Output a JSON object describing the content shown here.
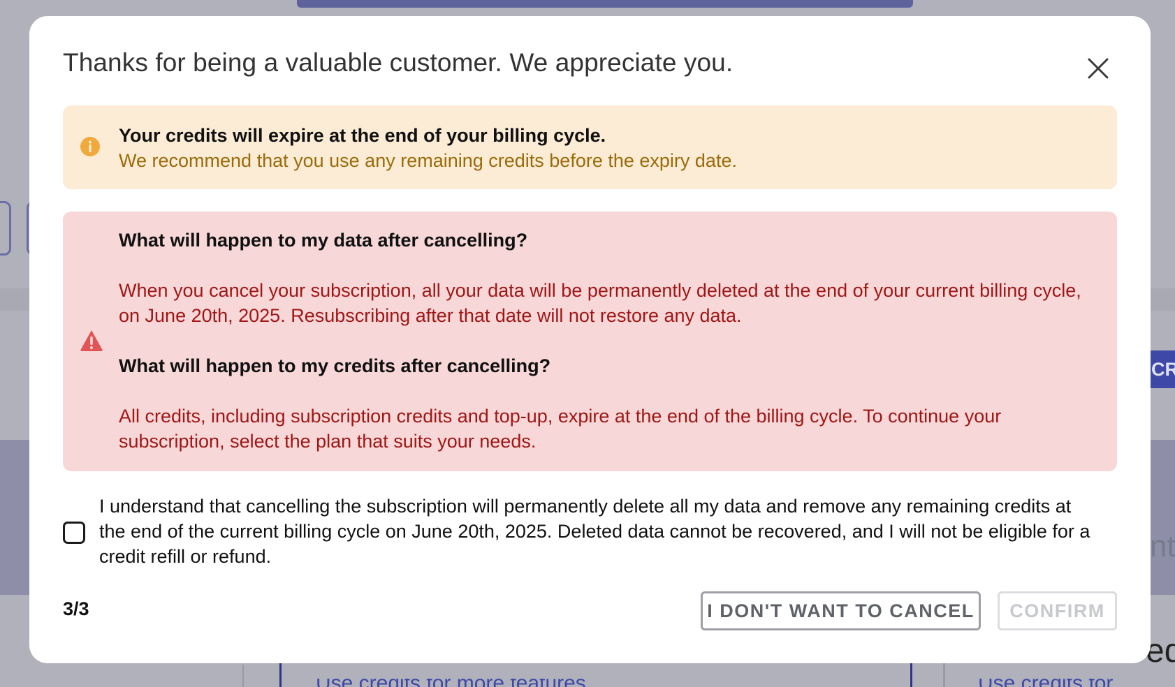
{
  "background": {
    "partial_button_text": "CR",
    "partial_text_right": "nt",
    "partial_heading_right": "ed",
    "partial_link_left": "Use credits for more features",
    "partial_link_right": "Use credits for"
  },
  "modal": {
    "title": "Thanks for being a valuable customer. We appreciate you.",
    "close_label": "Close",
    "warning_alert": {
      "icon": "info-icon",
      "heading": "Your credits will expire at the end of your billing cycle.",
      "body": "We recommend that you use any remaining credits before the expiry date."
    },
    "error_alert": {
      "icon": "warning-triangle-icon",
      "q1_heading": "What will happen to my data after cancelling?",
      "q1_body": "When you cancel your subscription, all your data will be permanently deleted at the end of your current billing cycle, on June 20th, 2025. Resubscribing after that date will not restore any data.",
      "q2_heading": "What will happen to my credits after cancelling?",
      "q2_body": "All credits, including subscription credits and top-up, expire at the end of the billing cycle. To continue your subscription, select the plan that suits your needs."
    },
    "acknowledgement": {
      "checked": false,
      "text": "I understand that cancelling the subscription will permanently delete all my data and remove any remaining credits at the end of the current billing cycle on June 20th, 2025. Deleted data cannot be recovered, and I will not be eligible for a credit refill or refund."
    },
    "footer": {
      "step": "3/3",
      "cancel_label": "I DON'T WANT TO CANCEL",
      "confirm_label": "CONFIRM"
    }
  },
  "colors": {
    "overlay": "#b1b1bb",
    "warning_bg": "#fcecd6",
    "warning_icon": "#f0a93a",
    "warning_text": "#9a6b0a",
    "error_bg": "#f7d7d7",
    "error_icon": "#e05555",
    "error_text": "#9f1616",
    "brand": "#3e48a6"
  }
}
